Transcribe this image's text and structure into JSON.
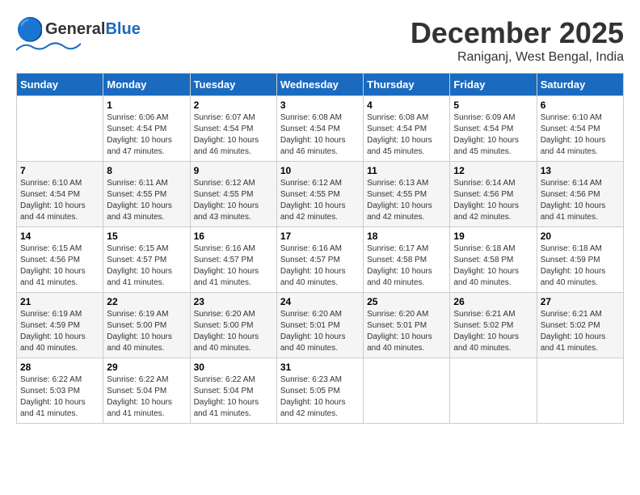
{
  "header": {
    "logo_general": "General",
    "logo_blue": "Blue",
    "month": "December 2025",
    "location": "Raniganj, West Bengal, India"
  },
  "weekdays": [
    "Sunday",
    "Monday",
    "Tuesday",
    "Wednesday",
    "Thursday",
    "Friday",
    "Saturday"
  ],
  "weeks": [
    [
      {
        "day": "",
        "info": ""
      },
      {
        "day": "1",
        "info": "Sunrise: 6:06 AM\nSunset: 4:54 PM\nDaylight: 10 hours\nand 47 minutes."
      },
      {
        "day": "2",
        "info": "Sunrise: 6:07 AM\nSunset: 4:54 PM\nDaylight: 10 hours\nand 46 minutes."
      },
      {
        "day": "3",
        "info": "Sunrise: 6:08 AM\nSunset: 4:54 PM\nDaylight: 10 hours\nand 46 minutes."
      },
      {
        "day": "4",
        "info": "Sunrise: 6:08 AM\nSunset: 4:54 PM\nDaylight: 10 hours\nand 45 minutes."
      },
      {
        "day": "5",
        "info": "Sunrise: 6:09 AM\nSunset: 4:54 PM\nDaylight: 10 hours\nand 45 minutes."
      },
      {
        "day": "6",
        "info": "Sunrise: 6:10 AM\nSunset: 4:54 PM\nDaylight: 10 hours\nand 44 minutes."
      }
    ],
    [
      {
        "day": "7",
        "info": "Sunrise: 6:10 AM\nSunset: 4:54 PM\nDaylight: 10 hours\nand 44 minutes."
      },
      {
        "day": "8",
        "info": "Sunrise: 6:11 AM\nSunset: 4:55 PM\nDaylight: 10 hours\nand 43 minutes."
      },
      {
        "day": "9",
        "info": "Sunrise: 6:12 AM\nSunset: 4:55 PM\nDaylight: 10 hours\nand 43 minutes."
      },
      {
        "day": "10",
        "info": "Sunrise: 6:12 AM\nSunset: 4:55 PM\nDaylight: 10 hours\nand 42 minutes."
      },
      {
        "day": "11",
        "info": "Sunrise: 6:13 AM\nSunset: 4:55 PM\nDaylight: 10 hours\nand 42 minutes."
      },
      {
        "day": "12",
        "info": "Sunrise: 6:14 AM\nSunset: 4:56 PM\nDaylight: 10 hours\nand 42 minutes."
      },
      {
        "day": "13",
        "info": "Sunrise: 6:14 AM\nSunset: 4:56 PM\nDaylight: 10 hours\nand 41 minutes."
      }
    ],
    [
      {
        "day": "14",
        "info": "Sunrise: 6:15 AM\nSunset: 4:56 PM\nDaylight: 10 hours\nand 41 minutes."
      },
      {
        "day": "15",
        "info": "Sunrise: 6:15 AM\nSunset: 4:57 PM\nDaylight: 10 hours\nand 41 minutes."
      },
      {
        "day": "16",
        "info": "Sunrise: 6:16 AM\nSunset: 4:57 PM\nDaylight: 10 hours\nand 41 minutes."
      },
      {
        "day": "17",
        "info": "Sunrise: 6:16 AM\nSunset: 4:57 PM\nDaylight: 10 hours\nand 40 minutes."
      },
      {
        "day": "18",
        "info": "Sunrise: 6:17 AM\nSunset: 4:58 PM\nDaylight: 10 hours\nand 40 minutes."
      },
      {
        "day": "19",
        "info": "Sunrise: 6:18 AM\nSunset: 4:58 PM\nDaylight: 10 hours\nand 40 minutes."
      },
      {
        "day": "20",
        "info": "Sunrise: 6:18 AM\nSunset: 4:59 PM\nDaylight: 10 hours\nand 40 minutes."
      }
    ],
    [
      {
        "day": "21",
        "info": "Sunrise: 6:19 AM\nSunset: 4:59 PM\nDaylight: 10 hours\nand 40 minutes."
      },
      {
        "day": "22",
        "info": "Sunrise: 6:19 AM\nSunset: 5:00 PM\nDaylight: 10 hours\nand 40 minutes."
      },
      {
        "day": "23",
        "info": "Sunrise: 6:20 AM\nSunset: 5:00 PM\nDaylight: 10 hours\nand 40 minutes."
      },
      {
        "day": "24",
        "info": "Sunrise: 6:20 AM\nSunset: 5:01 PM\nDaylight: 10 hours\nand 40 minutes."
      },
      {
        "day": "25",
        "info": "Sunrise: 6:20 AM\nSunset: 5:01 PM\nDaylight: 10 hours\nand 40 minutes."
      },
      {
        "day": "26",
        "info": "Sunrise: 6:21 AM\nSunset: 5:02 PM\nDaylight: 10 hours\nand 40 minutes."
      },
      {
        "day": "27",
        "info": "Sunrise: 6:21 AM\nSunset: 5:02 PM\nDaylight: 10 hours\nand 41 minutes."
      }
    ],
    [
      {
        "day": "28",
        "info": "Sunrise: 6:22 AM\nSunset: 5:03 PM\nDaylight: 10 hours\nand 41 minutes."
      },
      {
        "day": "29",
        "info": "Sunrise: 6:22 AM\nSunset: 5:04 PM\nDaylight: 10 hours\nand 41 minutes."
      },
      {
        "day": "30",
        "info": "Sunrise: 6:22 AM\nSunset: 5:04 PM\nDaylight: 10 hours\nand 41 minutes."
      },
      {
        "day": "31",
        "info": "Sunrise: 6:23 AM\nSunset: 5:05 PM\nDaylight: 10 hours\nand 42 minutes."
      },
      {
        "day": "",
        "info": ""
      },
      {
        "day": "",
        "info": ""
      },
      {
        "day": "",
        "info": ""
      }
    ]
  ]
}
